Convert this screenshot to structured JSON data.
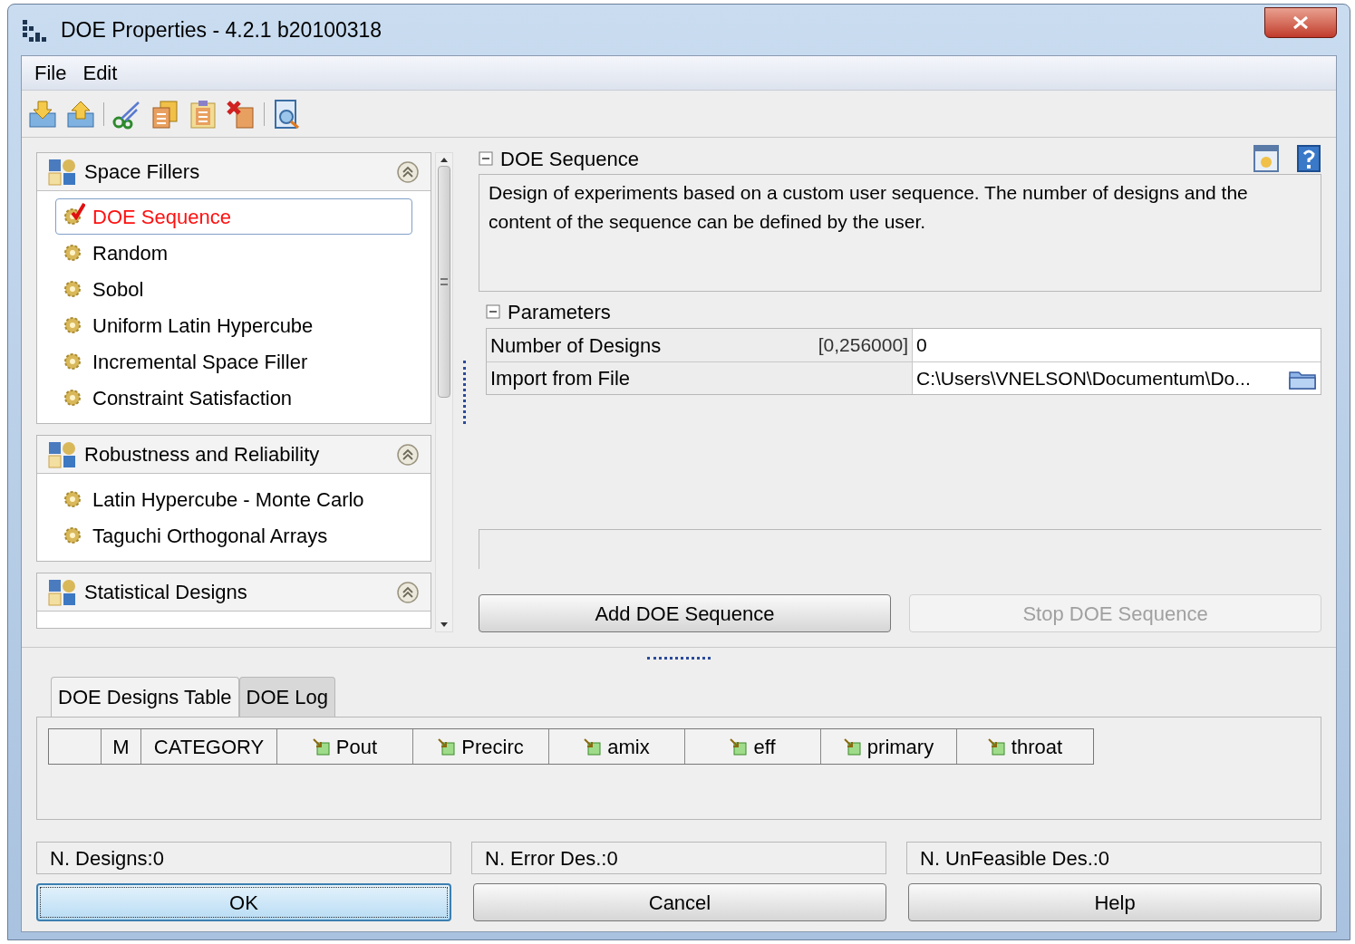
{
  "window": {
    "title": "DOE Properties - 4.2.1 b20100318"
  },
  "menu": [
    {
      "label": "File"
    },
    {
      "label": "Edit"
    }
  ],
  "groups": [
    {
      "title": "Space Fillers",
      "items": [
        {
          "label": "DOE Sequence",
          "selected": true
        },
        {
          "label": "Random",
          "selected": false
        },
        {
          "label": "Sobol",
          "selected": false
        },
        {
          "label": "Uniform Latin Hypercube",
          "selected": false
        },
        {
          "label": "Incremental Space Filler",
          "selected": false
        },
        {
          "label": "Constraint Satisfaction",
          "selected": false
        }
      ]
    },
    {
      "title": "Robustness and Reliability",
      "items": [
        {
          "label": "Latin Hypercube - Monte Carlo",
          "selected": false
        },
        {
          "label": "Taguchi Orthogonal Arrays",
          "selected": false
        }
      ]
    },
    {
      "title": "Statistical Designs"
    }
  ],
  "detail": {
    "title": "DOE Sequence",
    "description": "Design of experiments based on a custom user sequence. The number of designs and the content of the sequence can be defined by the user.",
    "parameters_title": "Parameters",
    "parameters": [
      {
        "name": "Number of Designs",
        "range": "[0,256000]",
        "value": "0",
        "kind": "number"
      },
      {
        "name": "Import from File",
        "value": "C:\\Users\\VNELSON\\Documentum\\Do...",
        "kind": "file"
      }
    ]
  },
  "actions": [
    {
      "label": "Add DOE Sequence",
      "disabled": false
    },
    {
      "label": "Stop DOE Sequence",
      "disabled": true
    }
  ],
  "tabs": [
    {
      "label": "DOE Designs Table",
      "selected": true
    },
    {
      "label": "DOE Log",
      "selected": false
    }
  ],
  "columns": [
    {
      "label": "M",
      "kind": "plain"
    },
    {
      "label": "CATEGORY",
      "kind": "plain"
    },
    {
      "label": "Pout",
      "kind": "variable"
    },
    {
      "label": "Precirc",
      "kind": "variable"
    },
    {
      "label": "amix",
      "kind": "variable"
    },
    {
      "label": "eff",
      "kind": "variable"
    },
    {
      "label": "primary",
      "kind": "variable"
    },
    {
      "label": "throat",
      "kind": "variable"
    }
  ],
  "status": [
    {
      "text": "N. Designs:0"
    },
    {
      "text": "N. Error Des.:0"
    },
    {
      "text": "N. UnFeasible Des.:0"
    }
  ],
  "buttons": [
    {
      "label": "OK",
      "focused": true
    },
    {
      "label": "Cancel",
      "focused": false
    },
    {
      "label": "Help",
      "focused": false
    }
  ]
}
